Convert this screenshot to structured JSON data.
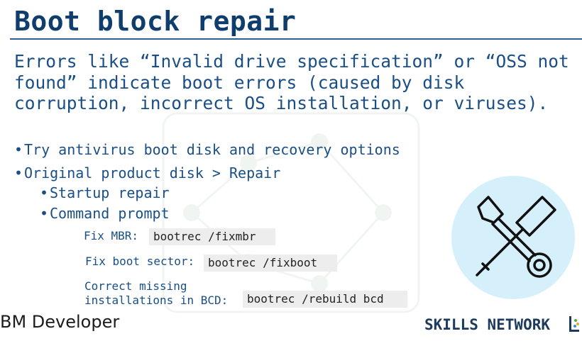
{
  "slide": {
    "title": "Boot block repair",
    "intro": "Errors like “Invalid drive specification” or “OSS not found” indicate boot errors (caused by disk corruption, incorrect OS installation, or viruses).",
    "bullets": [
      {
        "text": "Try antivirus boot disk and recovery options"
      },
      {
        "text": "Original product disk > Repair"
      }
    ],
    "sub_bullets": [
      {
        "text": "Startup repair"
      },
      {
        "text": "Command prompt"
      }
    ],
    "bullet_glyph": "•",
    "commands": [
      {
        "label": "Fix MBR:",
        "code": "bootrec /fixmbr"
      },
      {
        "label": "Fix boot sector:",
        "code": "bootrec /fixboot"
      },
      {
        "label": "Correct missing installations in BCD:",
        "code": "bootrec /rebuild bcd"
      }
    ]
  },
  "footer": {
    "left_brand": "BM Developer",
    "right_brand": "SKILLS NETWORK"
  },
  "icons": {
    "tools": "wrench-screwdriver-icon",
    "logo": "skills-network-logo-icon"
  },
  "colors": {
    "title": "#0f3d6e",
    "text": "#1a4f86",
    "code_bg": "#ededed",
    "icon_bg": "#d6f0fb"
  }
}
